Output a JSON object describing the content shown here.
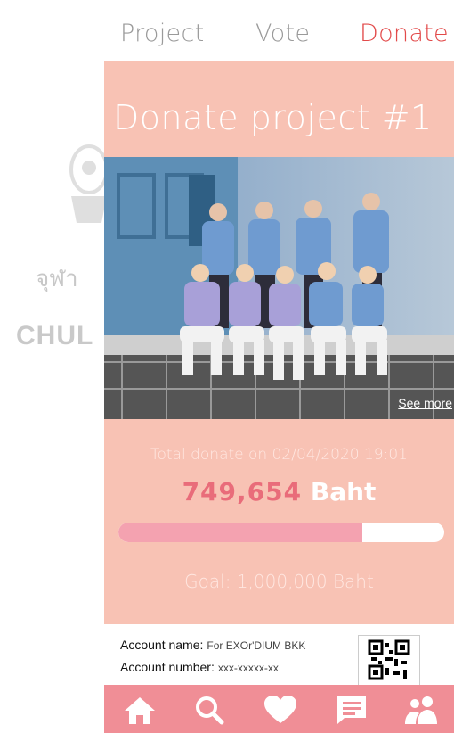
{
  "watermark": {
    "line1": "จุฬา",
    "line2": "CHUL"
  },
  "topnav": {
    "tabs": [
      "Project",
      "Vote",
      "Donate"
    ],
    "active_tab": "Donate",
    "active_color": "#e24a4a"
  },
  "page": {
    "title": "Donate project #1"
  },
  "photo": {
    "see_more": "See more"
  },
  "donation": {
    "total_label": "Total donate on 02/04/2020 19:01",
    "amount": "749,654",
    "unit": "Baht",
    "progress": 0.749654,
    "goal_label": "Goal: 1,000,000 Baht"
  },
  "account": {
    "name_label": "Account name:",
    "name_value": "For EXOr'DIUM BKK",
    "number_label": "Account number:",
    "number_value": "xxx-xxxxx-xx"
  },
  "bottomnav": {
    "icons": [
      "home-icon",
      "search-icon",
      "heart-icon",
      "chat-icon",
      "people-icon"
    ]
  },
  "colors": {
    "background": "#f8c2b4",
    "bottomnav": "#f08e96",
    "amount": "#e96c7a",
    "progress_fill": "#f4a2b0"
  }
}
